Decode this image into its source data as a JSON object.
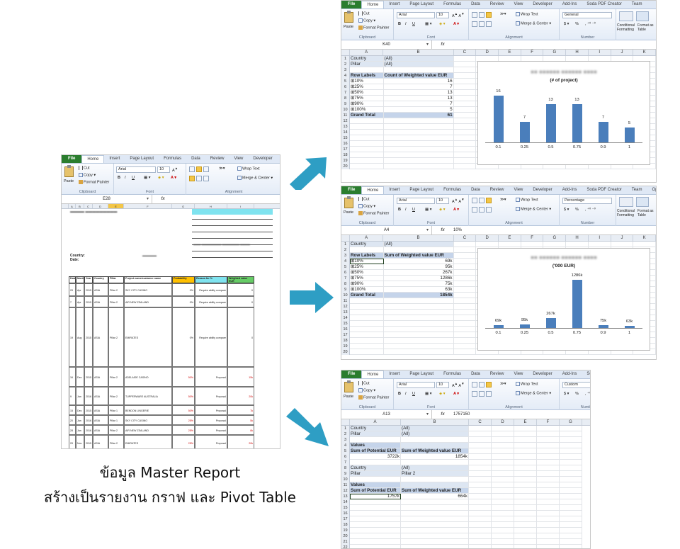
{
  "ribbon": {
    "tabs": [
      "File",
      "Home",
      "Insert",
      "Page Layout",
      "Formulas",
      "Data",
      "Review",
      "View",
      "Developer",
      "Add-Ins",
      "Soda PDF Creator",
      "Team"
    ],
    "tabs_short": [
      "File",
      "Home",
      "Insert",
      "Page Layout",
      "Formulas",
      "Data",
      "Review",
      "View",
      "Developer",
      "Add-"
    ],
    "tabs_mid": [
      "File",
      "Home",
      "Insert",
      "Page Layout",
      "Formulas",
      "Data",
      "Review",
      "View",
      "Developer",
      "Add-Ins",
      "Soda PDF Creator",
      "Team",
      "Optic"
    ],
    "tabs_bottom": [
      "File",
      "Home",
      "Insert",
      "Page Layout",
      "Formulas",
      "Data",
      "Review",
      "View",
      "Developer",
      "Add-Ins",
      "Soda P"
    ],
    "cut": "Cut",
    "copy": "Copy",
    "format_painter": "Format Painter",
    "paste": "Paste",
    "clipboard": "Clipboard",
    "font_group": "Font",
    "alignment": "Alignment",
    "number": "Number",
    "font": "Arial",
    "size": "10",
    "wrap_text": "Wrap Text",
    "merge_center": "Merge & Center",
    "conditional_formatting": "Conditional Formatting",
    "format_as_table": "Format as Table",
    "bold": "B",
    "italic": "I",
    "underline": "U",
    "currency": "$",
    "percent": "%"
  },
  "top": {
    "name_box": "K40",
    "formula": "",
    "number_format": "General",
    "columns": [
      "A",
      "B",
      "C",
      "D",
      "E",
      "F",
      "G",
      "H",
      "I",
      "J",
      "K"
    ],
    "filters": [
      {
        "label": "Country",
        "value": "(All)"
      },
      {
        "label": "Pillar",
        "value": "(All)"
      }
    ],
    "headers": [
      "Row Labels",
      "Count of Weighted value EUR"
    ],
    "rows": [
      {
        "label": "10%",
        "value": "16"
      },
      {
        "label": "25%",
        "value": "7"
      },
      {
        "label": "50%",
        "value": "13"
      },
      {
        "label": "75%",
        "value": "13"
      },
      {
        "label": "90%",
        "value": "7"
      },
      {
        "label": "100%",
        "value": "5"
      }
    ],
    "grand_total_label": "Grand Total",
    "grand_total": "61",
    "row_numbers": [
      "1",
      "2",
      "3",
      "4",
      "5",
      "6",
      "7",
      "8",
      "9",
      "10",
      "11",
      "12",
      "13",
      "14",
      "15",
      "16",
      "17",
      "18",
      "19",
      "20"
    ],
    "chart_subtitle": "(# of project)"
  },
  "mid": {
    "name_box": "A4",
    "formula": "10%",
    "number_format": "Percentage",
    "columns": [
      "A",
      "B",
      "C",
      "D",
      "E",
      "F",
      "G",
      "H",
      "I",
      "J",
      "K"
    ],
    "filters": [
      {
        "label": "Country",
        "value": "(All)"
      }
    ],
    "headers": [
      "Row Labels",
      "Sum of Weighted value EUR"
    ],
    "rows": [
      {
        "label": "10%",
        "value": "69k"
      },
      {
        "label": "25%",
        "value": "95k"
      },
      {
        "label": "50%",
        "value": "267k"
      },
      {
        "label": "75%",
        "value": "1286k"
      },
      {
        "label": "90%",
        "value": "75k"
      },
      {
        "label": "100%",
        "value": "63k"
      }
    ],
    "grand_total_label": "Grand Total",
    "grand_total": "1854k",
    "row_numbers": [
      "1",
      "2",
      "3",
      "4",
      "5",
      "6",
      "7",
      "8",
      "9",
      "10",
      "11",
      "12",
      "13",
      "14",
      "15",
      "16",
      "17",
      "18",
      "19",
      "20"
    ],
    "chart_subtitle": "('000 EUR)"
  },
  "bottom": {
    "name_box": "A13",
    "formula": "1757150",
    "number_format": "Custom",
    "columns": [
      "A",
      "B",
      "C",
      "D",
      "E",
      "F",
      "G"
    ],
    "row_numbers": [
      "1",
      "2",
      "3",
      "4",
      "5",
      "6",
      "7",
      "8",
      "9",
      "10",
      "11",
      "12",
      "13",
      "14",
      "15",
      "16",
      "17",
      "18",
      "19",
      "20",
      "21",
      "22"
    ],
    "block1": {
      "country": "Country",
      "country_val": "(All)",
      "pillar": "Pillar",
      "pillar_val": "(All)",
      "values": "Values",
      "h1": "Sum of Potential EUR",
      "h2": "Sum of Weighted value EUR",
      "v1": "3722k",
      "v2": "1854k"
    },
    "block2": {
      "country": "Country",
      "country_val": "(All)",
      "pillar": "Pillar",
      "pillar_val": "Pillar 2",
      "values": "Values",
      "h1": "Sum of Potential EUR",
      "h2": "Sum of Weighted value EUR",
      "v1": "1757k",
      "v2": "664k"
    }
  },
  "master": {
    "name_box": "E28",
    "columns": [
      "A",
      "B",
      "C",
      "D",
      "E",
      "F",
      "G",
      "H",
      "I"
    ],
    "labels": {
      "country": "Country:",
      "date": "Date:"
    },
    "headers": [
      "Date",
      "Month",
      "Year",
      "Country",
      "Pillar",
      "Project name/customer name",
      "Probability",
      "Reason for %",
      "Weighted value EUR"
    ],
    "rows": [
      {
        "d": "29",
        "m": "Apr",
        "y": "2015",
        "c": "ASIA",
        "p": "Pillar 2",
        "name": "SKY CITY CASINO",
        "prob": "0%",
        "reason": "Require ability compare",
        "val": "0"
      },
      {
        "d": "7",
        "m": "Apr",
        "y": "2015",
        "c": "ASIA",
        "p": "Pillar 2",
        "name": "AIR NEW ZEALAND",
        "prob": "0%",
        "reason": "Require ability compare",
        "val": "0"
      },
      {
        "d": "19",
        "m": "Aug",
        "y": "2015",
        "c": "ASIA",
        "p": "Pillar 2",
        "name": "EMIRATES",
        "prob": "0%",
        "reason": "Require ability compare",
        "val": "0"
      },
      {
        "d": "16",
        "m": "Dec",
        "y": "2015",
        "c": "ASIA",
        "p": "Pillar 2",
        "name": "ADELAIDE CASINO",
        "prob": "50%",
        "reason": "Proposal",
        "val": "15k"
      },
      {
        "d": "9",
        "m": "Jan",
        "y": "2016",
        "c": "ASIA",
        "p": "Pillar 2",
        "name": "TUPPERWARE AUSTRALIA",
        "prob": "50%",
        "reason": "Proposal",
        "val": "20k"
      },
      {
        "d": "15",
        "m": "Dec",
        "y": "2015",
        "c": "ASIA",
        "p": "Pillar 1",
        "name": "BENDON LINGERIE",
        "prob": "50%",
        "reason": "Proposal",
        "val": "7k"
      },
      {
        "d": "20",
        "m": "Jan",
        "y": "2016",
        "c": "ASIA",
        "p": "Pillar 1",
        "name": "SKY CITY CASINO",
        "prob": "25%",
        "reason": "Proposal",
        "val": "5k"
      },
      {
        "d": "28",
        "m": "Jan",
        "y": "2016",
        "c": "ASIA",
        "p": "Pillar 2",
        "name": "AIR NEW ZEALAND",
        "prob": "25%",
        "reason": "Proposal",
        "val": "8k"
      },
      {
        "d": "29",
        "m": "Nov",
        "y": "2015",
        "c": "ASIA",
        "p": "Pillar 2",
        "name": "EMIRATES",
        "prob": "25%",
        "reason": "Proposal",
        "val": "20k"
      }
    ],
    "footer_label": "pipeline value",
    "footer_value": "75k"
  },
  "caption": {
    "line1": "ข้อมูล Master Report",
    "line2": "สร้างเป็นรายงาน กราฟ และ Pivot Table"
  },
  "colors": {
    "accent": "#2e9ec4",
    "bar": "#4a7ebb",
    "file_tab": "#2a7d2e"
  },
  "chart_data": [
    {
      "type": "bar",
      "categories": [
        "0.1",
        "0.25",
        "0.5",
        "0.75",
        "0.9",
        "1"
      ],
      "values": [
        16,
        7,
        13,
        13,
        7,
        5
      ],
      "labels": [
        "16",
        "7",
        "13",
        "13",
        "7",
        "5"
      ],
      "title": "",
      "subtitle": "(# of project)"
    },
    {
      "type": "bar",
      "categories": [
        "0.1",
        "0.25",
        "0.5",
        "0.75",
        "0.9",
        "1"
      ],
      "values": [
        69,
        95,
        267,
        1286,
        75,
        63
      ],
      "labels": [
        "69k",
        "95k",
        "267k",
        "1286k",
        "75k",
        "63k"
      ],
      "title": "",
      "subtitle": "('000 EUR)"
    }
  ]
}
